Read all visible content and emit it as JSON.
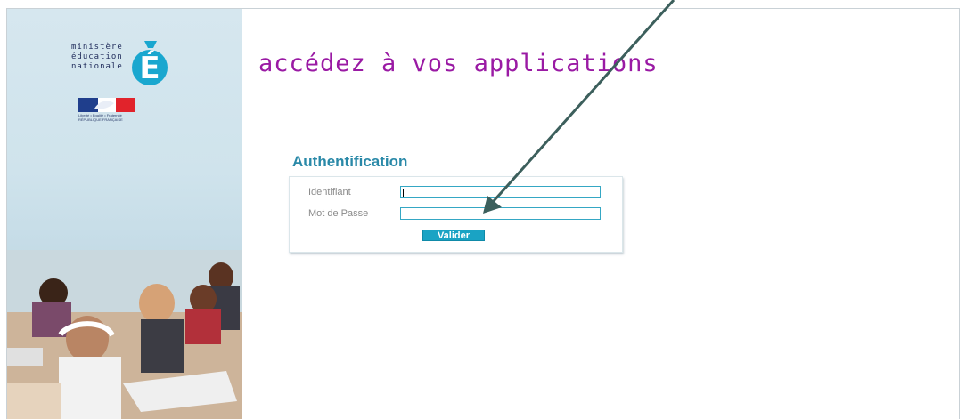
{
  "logo": {
    "line1": "ministère",
    "line2": "éducation",
    "line3": "nationale",
    "letter": "É",
    "flag_caption": "Liberté • Égalité • Fraternité RÉPUBLIQUE FRANÇAISE"
  },
  "headline": "accédez à vos applications",
  "auth": {
    "title": "Authentification",
    "username_label": "Identifiant",
    "username_value": "",
    "password_label": "Mot de Passe",
    "password_value": "",
    "submit_label": "Valider"
  },
  "colors": {
    "headline": "#9a1aa4",
    "auth_title": "#2a89a8",
    "field_border": "#35a7c4",
    "button_bg": "#1aa3c4",
    "arrow": "#3c5f5c"
  }
}
